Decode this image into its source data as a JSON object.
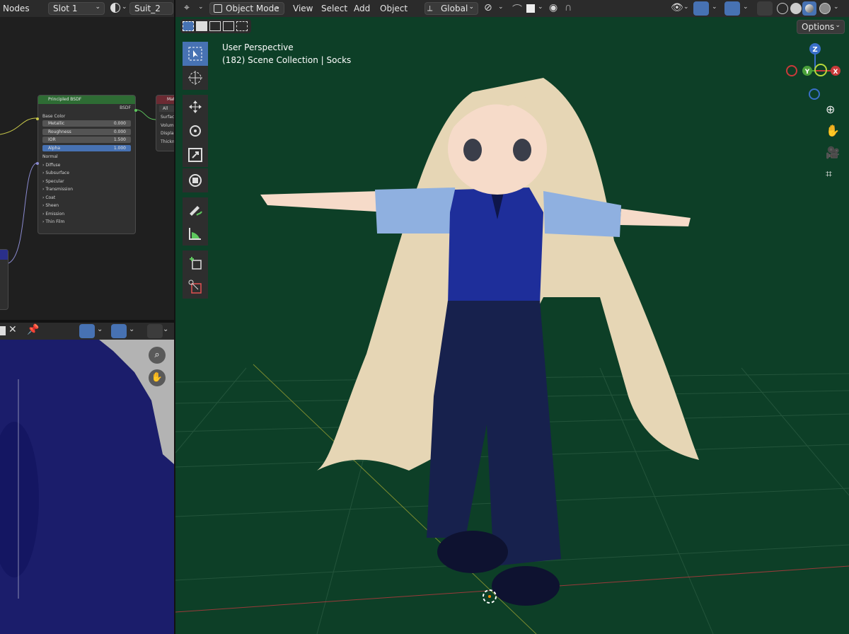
{
  "node_editor": {
    "header": {
      "label": "Nodes",
      "slot": "Slot 1",
      "material": "Suit_2"
    },
    "node": {
      "title": "Principled BSDF",
      "output": "BSDF",
      "rows": [
        {
          "label": "Base Color"
        },
        {
          "label": "Metallic",
          "value": "0.000"
        },
        {
          "label": "Roughness",
          "value": "0.000"
        },
        {
          "label": "IOR",
          "value": "1.500"
        },
        {
          "label": "Alpha",
          "value": "1.000"
        },
        {
          "label": "Normal"
        }
      ],
      "panels": [
        "Diffuse",
        "Subsurface",
        "Specular",
        "Transmission",
        "Coat",
        "Sheen",
        "Emission",
        "Thin Film"
      ]
    },
    "output_node": {
      "title": "Mat",
      "target": "All",
      "inputs": [
        "Surface",
        "Volume",
        "Displace",
        "Thickn"
      ]
    }
  },
  "viewport": {
    "header": {
      "mode": "Object Mode",
      "menus": [
        "View",
        "Select",
        "Add",
        "Object"
      ],
      "transform_orientation": "Global"
    },
    "options_label": "Options",
    "overlay_line1": "User Perspective",
    "overlay_line2": "(182) Scene Collection | Socks",
    "gizmo_axes": [
      "Z",
      "Y",
      "X"
    ]
  },
  "colors": {
    "viewport_bg": "#0d3f27",
    "active_tool": "#4772b3",
    "node_header_green": "#2e6c34",
    "vest_blue": "#1e2e9a",
    "pants_navy": "#17214d",
    "hair": "#e6d6b5"
  },
  "icons": [
    "select-box-icon",
    "cursor-icon",
    "move-icon",
    "rotate-icon",
    "scale-icon",
    "transform-icon",
    "annotate-icon",
    "measure-icon",
    "add-cube-icon",
    "knife-icon",
    "zoom-icon",
    "hand-icon",
    "camera-icon",
    "grid-icon"
  ]
}
